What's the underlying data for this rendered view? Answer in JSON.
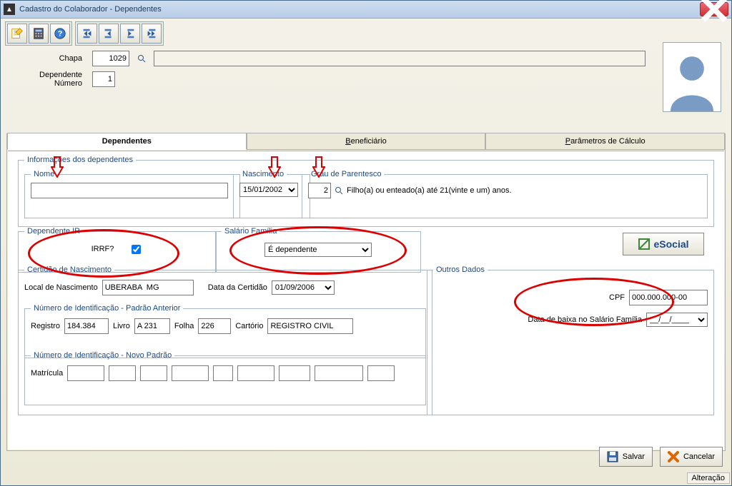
{
  "window": {
    "title": "Cadastro do Colaborador - Dependentes"
  },
  "header": {
    "chapa_label": "Chapa",
    "chapa_value": "1029",
    "nome_value": "",
    "dep_num_label": "Dependente Número",
    "dep_num_value": "1"
  },
  "tabs": {
    "dependentes": "Dependentes",
    "beneficiario": "Beneficiário",
    "beneficiario_key": "B",
    "parametros": "Parâmetros de Cálculo",
    "parametros_key": "P"
  },
  "info": {
    "fs_label": "Informações dos dependentes",
    "nome_label": "Nome",
    "nome_value": "",
    "nasc_label": "Nascimento",
    "nasc_value": "15/01/2002",
    "grau_label": "Grau de Parentesco",
    "grau_value": "2",
    "grau_desc": "Filho(a) ou enteado(a) até 21(vinte e um) anos."
  },
  "ir": {
    "fs_label": "Dependente IR",
    "irrf_label": "IRRF?"
  },
  "salfam": {
    "fs_label": "Salário Família",
    "options": [
      "É dependente"
    ],
    "selected": "É dependente"
  },
  "esocial": {
    "label": "eSocial"
  },
  "cert": {
    "fs_label": "Certidão de Nascimento",
    "local_label": "Local de Nascimento",
    "local_value": "UBERABA  MG",
    "data_label": "Data da Certidão",
    "data_value": "01/09/2006",
    "numant_label": "Número de Identificação - Padrão Anterior",
    "reg_label": "Registro",
    "reg_value": "184.384",
    "livro_label": "Livro",
    "livro_value": "A 231",
    "folha_label": "Folha",
    "folha_value": "226",
    "cartorio_label": "Cartório",
    "cartorio_value": "REGISTRO CIVIL",
    "numnovo_label": "Número de Identificação - Novo Padrão",
    "matricula_label": "Matrícula"
  },
  "outros": {
    "fs_label": "Outros Dados",
    "cpf_label": "CPF",
    "cpf_value": "000.000.000-00",
    "baixa_label": "Data de baixa no Salário Família",
    "baixa_value": "__/__/____"
  },
  "footer": {
    "salvar": "Salvar",
    "cancelar": "Cancelar"
  },
  "status": {
    "text": "Alteração"
  }
}
